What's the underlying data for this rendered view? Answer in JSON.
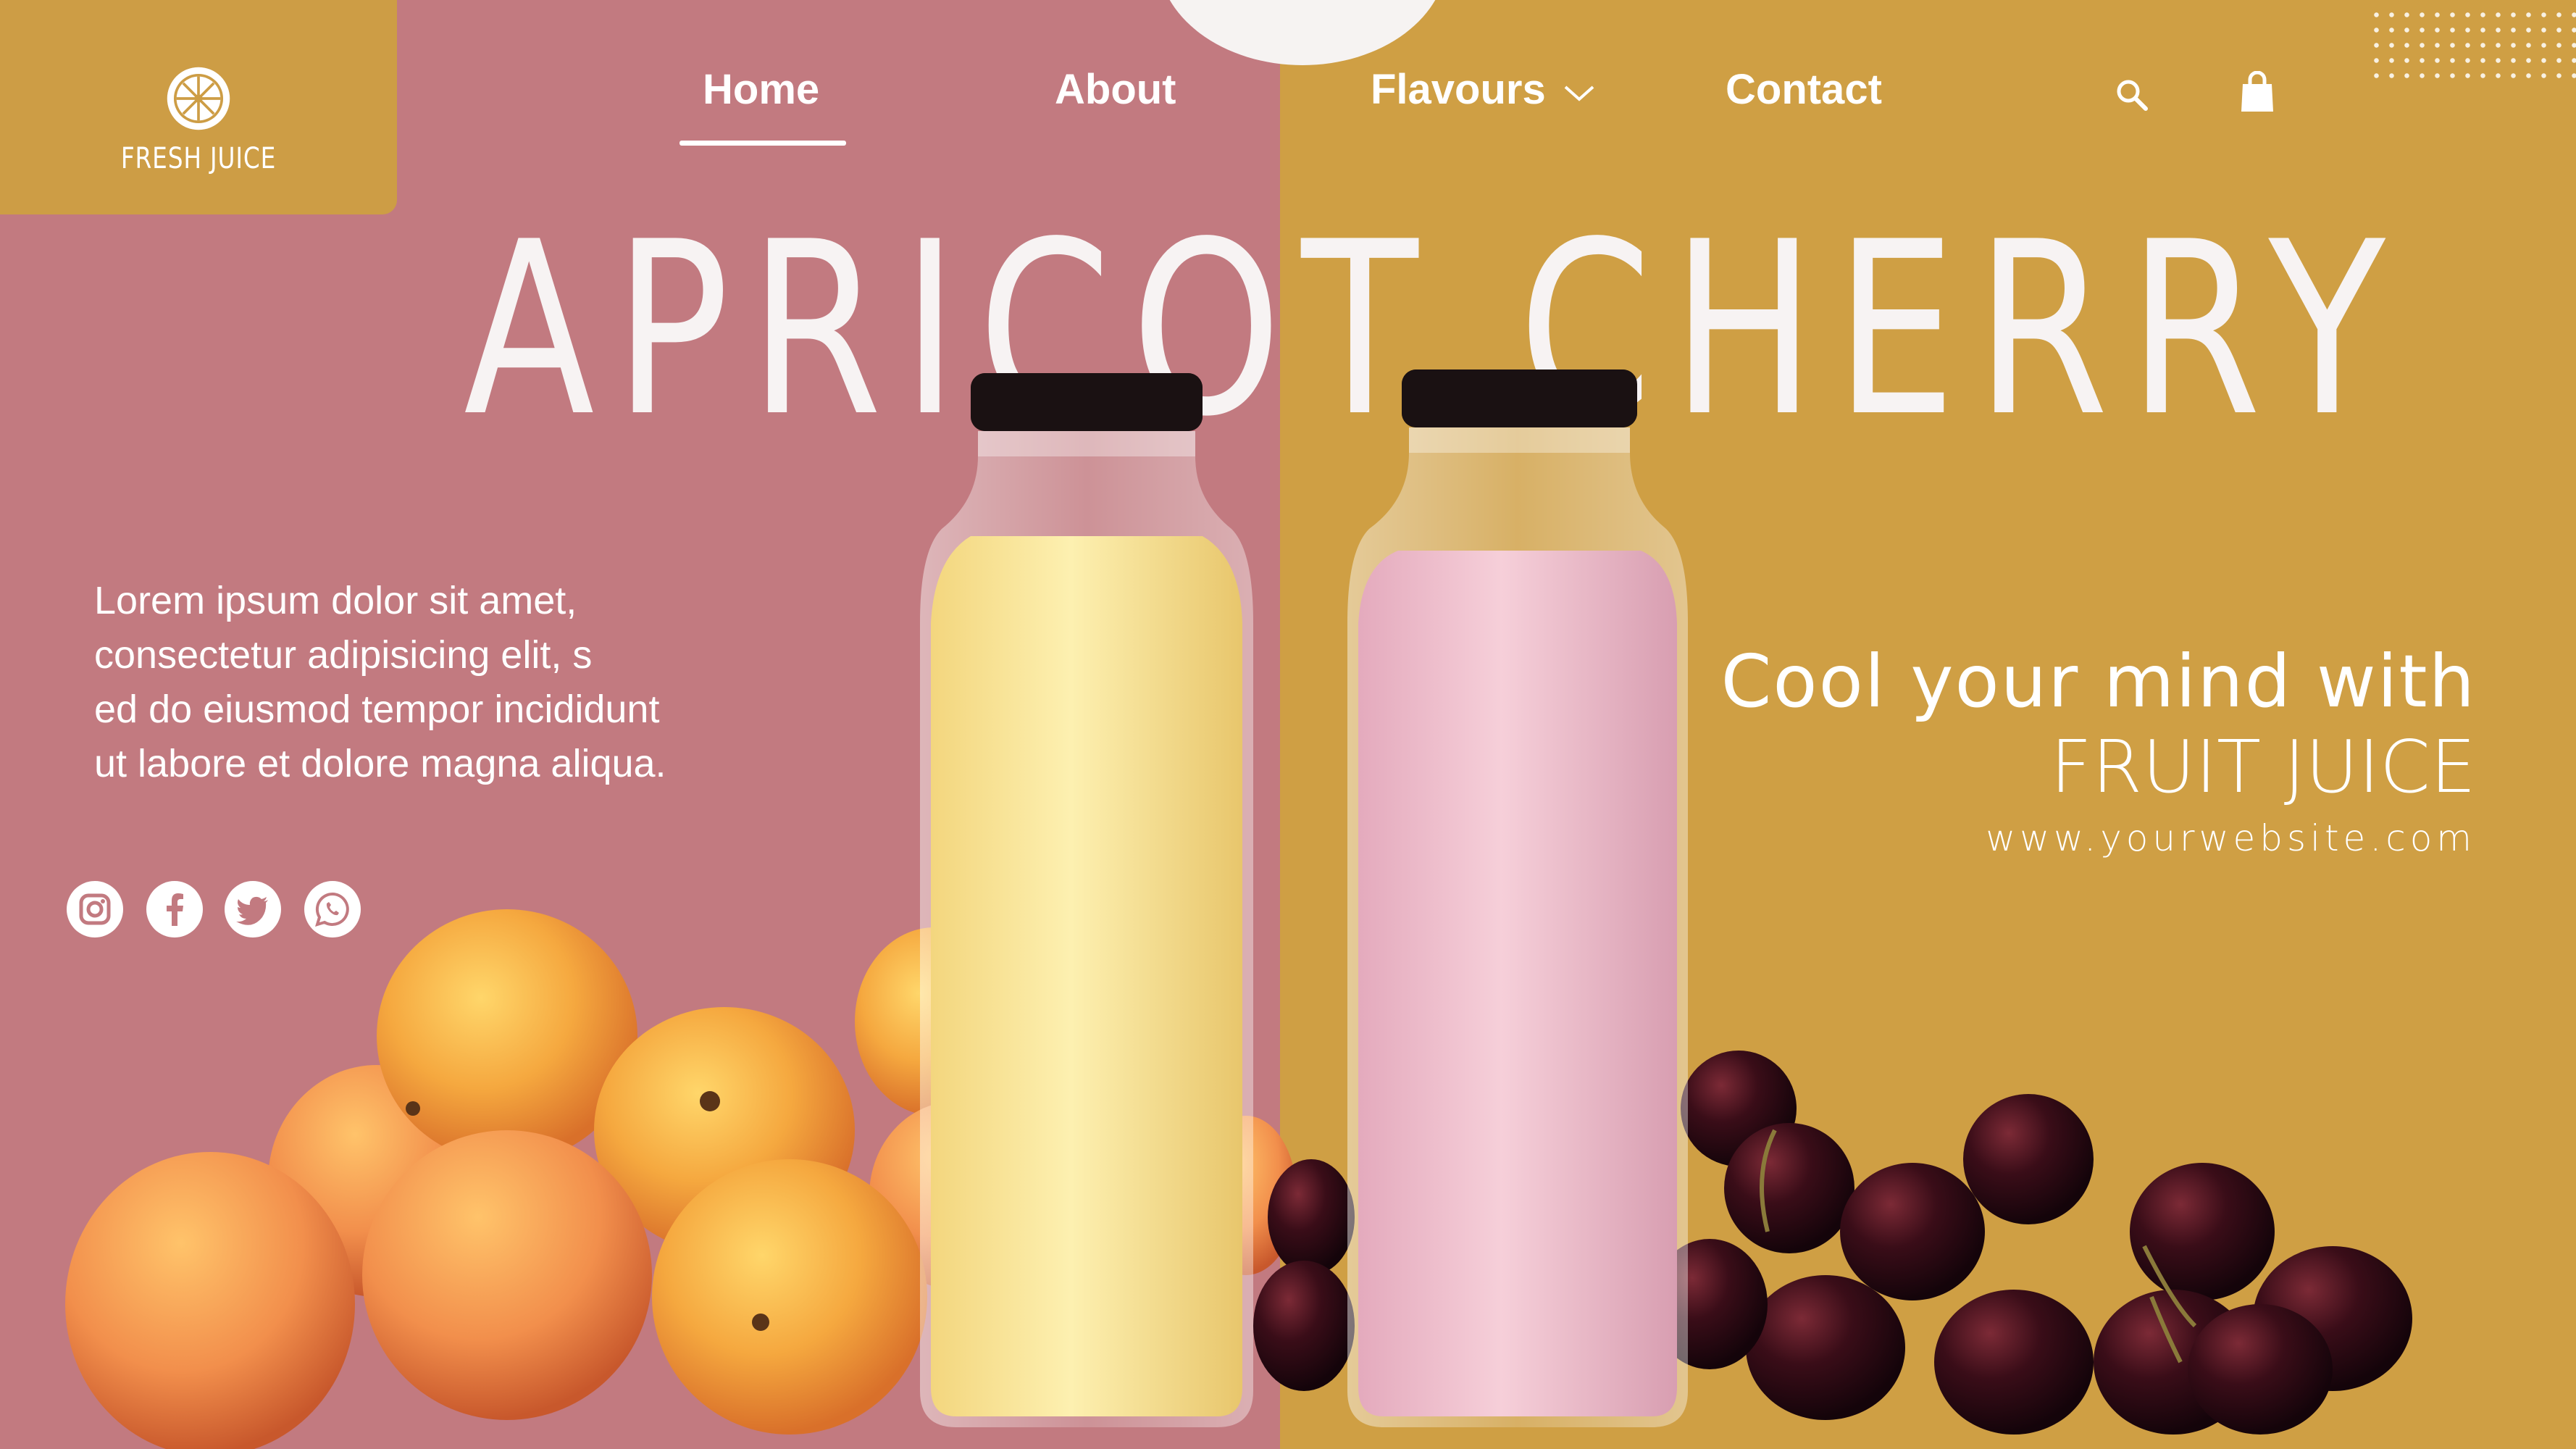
{
  "brand": {
    "name": "FRESH JUICE",
    "logo_icon": "orange-slice-icon"
  },
  "colors": {
    "left_panel": "#c27a80",
    "right_panel": "#cf9f44",
    "logo_box": "#cd9d45",
    "text": "#ffffff"
  },
  "nav": {
    "items": [
      {
        "label": "Home",
        "active": true
      },
      {
        "label": "About"
      },
      {
        "label": "Flavours",
        "has_dropdown": true
      },
      {
        "label": "Contact"
      }
    ],
    "icons": [
      "search-icon",
      "shopping-bag-icon"
    ]
  },
  "hero": {
    "headline": "APRICOT CHERRY",
    "body_lines": [
      "Lorem ipsum dolor sit amet,",
      "consectetur adipisicing elit, s",
      "ed do eiusmod tempor incididunt",
      "ut labore et dolore magna aliqua."
    ],
    "tagline_line1": "Cool your mind with",
    "tagline_line2": "FRUIT JUICE",
    "website": "www.yourwebsite.com"
  },
  "social": [
    "instagram-icon",
    "facebook-icon",
    "twitter-icon",
    "whatsapp-icon"
  ]
}
